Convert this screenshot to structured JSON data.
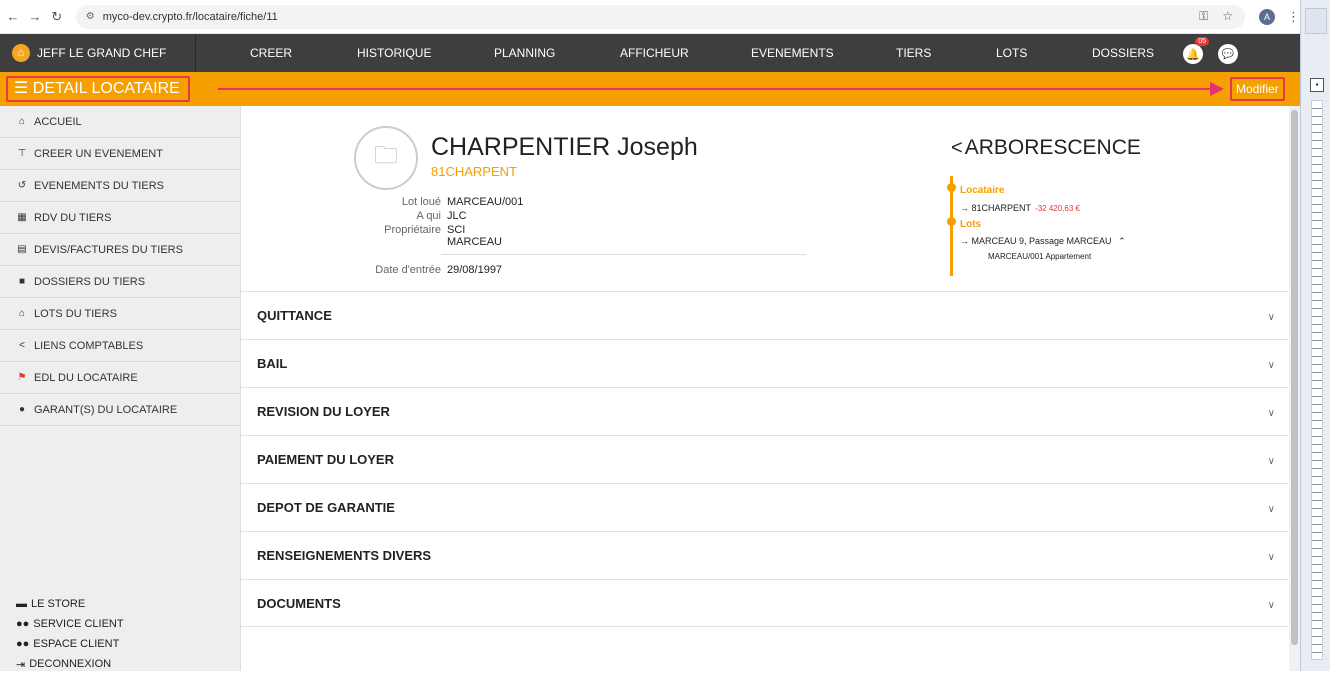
{
  "browser": {
    "url": "myco-dev.crypto.fr/locataire/fiche/11",
    "profile_initial": "A"
  },
  "navbar": {
    "brand": "JEFF LE GRAND CHEF",
    "links": [
      "CREER",
      "HISTORIQUE",
      "PLANNING",
      "AFFICHEUR",
      "EVENEMENTS",
      "TIERS",
      "LOTS",
      "DOSSIERS"
    ],
    "notification_count": "05"
  },
  "header": {
    "title": "DETAIL LOCATAIRE",
    "modify_label": "Modifier"
  },
  "sidebar": {
    "items": [
      {
        "icon": "home-icon",
        "label": "ACCUEIL"
      },
      {
        "icon": "pin-icon",
        "label": "CREER UN EVENEMENT"
      },
      {
        "icon": "history-icon",
        "label": "EVENEMENTS DU TIERS"
      },
      {
        "icon": "calendar-icon",
        "label": "RDV DU TIERS"
      },
      {
        "icon": "invoice-icon",
        "label": "DEVIS/FACTURES DU TIERS"
      },
      {
        "icon": "folder-icon",
        "label": "DOSSIERS DU TIERS"
      },
      {
        "icon": "building-icon",
        "label": "LOTS DU TIERS"
      },
      {
        "icon": "share-icon",
        "label": "LIENS COMPTABLES"
      },
      {
        "icon": "edl-icon",
        "label": "EDL DU LOCATAIRE"
      },
      {
        "icon": "user-icon",
        "label": "GARANT(S) DU LOCATAIRE"
      }
    ],
    "bottom": [
      {
        "icon": "store-icon",
        "label": "LE STORE"
      },
      {
        "icon": "users-icon",
        "label": "SERVICE CLIENT"
      },
      {
        "icon": "group-icon",
        "label": "ESPACE CLIENT"
      },
      {
        "icon": "logout-icon",
        "label": "DECONNEXION"
      }
    ]
  },
  "tenant": {
    "name": "CHARPENTIER Joseph",
    "code": "81CHARPENT",
    "fields": [
      {
        "label": "Lot loué",
        "value": "MARCEAU/001"
      },
      {
        "label": "A qui",
        "value": "JLC"
      },
      {
        "label": "Propriétaire",
        "value": "SCI MARCEAU"
      }
    ],
    "entry": {
      "label": "Date d'entrée",
      "value": "29/08/1997"
    }
  },
  "tree": {
    "title": "ARBORESCENCE",
    "tenant_heading": "Locataire",
    "tenant_entry": "81CHARPENT",
    "tenant_balance": "-32 420,63 €",
    "lots_heading": "Lots",
    "lot_entry": "MARCEAU 9, Passage MARCEAU",
    "lot_sub": "MARCEAU/001 Appartement"
  },
  "sections": [
    "QUITTANCE",
    "BAIL",
    "REVISION DU LOYER",
    "PAIEMENT DU LOYER",
    "DEPOT DE GARANTIE",
    "RENSEIGNEMENTS DIVERS",
    "DOCUMENTS"
  ],
  "colors": {
    "accent": "#f5a000",
    "navbar": "#3e3e3e",
    "highlight": "#e63946",
    "negative": "#e53935"
  }
}
